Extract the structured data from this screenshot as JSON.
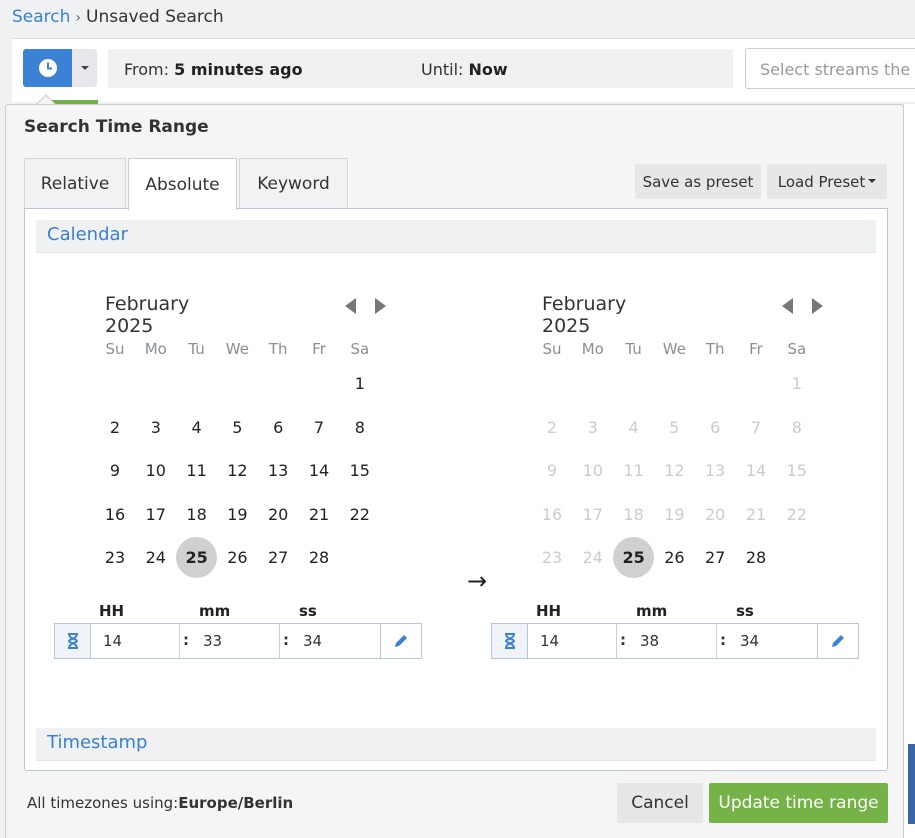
{
  "breadcrumb": {
    "link": "Search",
    "separator": "›",
    "current": "Unsaved Search"
  },
  "search_bar": {
    "from_label": "From:",
    "from_value": "5 minutes ago",
    "until_label": "Until:",
    "until_value": "Now",
    "streams_placeholder": "Select streams the se"
  },
  "popover": {
    "title": "Search Time Range",
    "tabs": [
      {
        "label": "Relative"
      },
      {
        "label": "Absolute"
      },
      {
        "label": "Keyword"
      }
    ],
    "active_tab": "Absolute",
    "save_preset_label": "Save as preset",
    "load_preset_label": "Load Preset",
    "calendar_section": "Calendar",
    "timestamp_section": "Timestamp",
    "time_labels": {
      "hh": "HH",
      "mm": "mm",
      "ss": "ss"
    },
    "weekdays": [
      "Su",
      "Mo",
      "Tu",
      "We",
      "Th",
      "Fr",
      "Sa"
    ],
    "from_calendar": {
      "month": "February 2025",
      "selected_day": 25,
      "disabled_days": [],
      "time": {
        "hh": "14",
        "mm": "33",
        "ss": "34"
      }
    },
    "to_calendar": {
      "month": "February 2025",
      "selected_day": 25,
      "disabled_days": [
        1,
        2,
        3,
        4,
        5,
        6,
        7,
        8,
        9,
        10,
        11,
        12,
        13,
        14,
        15,
        16,
        17,
        18,
        19,
        20,
        21,
        22,
        23,
        24
      ],
      "time": {
        "hh": "14",
        "mm": "38",
        "ss": "34"
      }
    },
    "arrow": "→",
    "timezone_label": "All timezones using:",
    "timezone_value": "Europe/Berlin",
    "cancel_label": "Cancel",
    "update_label": "Update time range"
  },
  "colors": {
    "accent": "#3b82d6",
    "success": "#75b247",
    "link": "#3a7fd5"
  },
  "icons": [
    "clock-icon",
    "caret-down-icon",
    "chevron-left-icon",
    "chevron-right-icon",
    "arrow-right-icon",
    "hourglass-icon",
    "pencil-icon"
  ]
}
